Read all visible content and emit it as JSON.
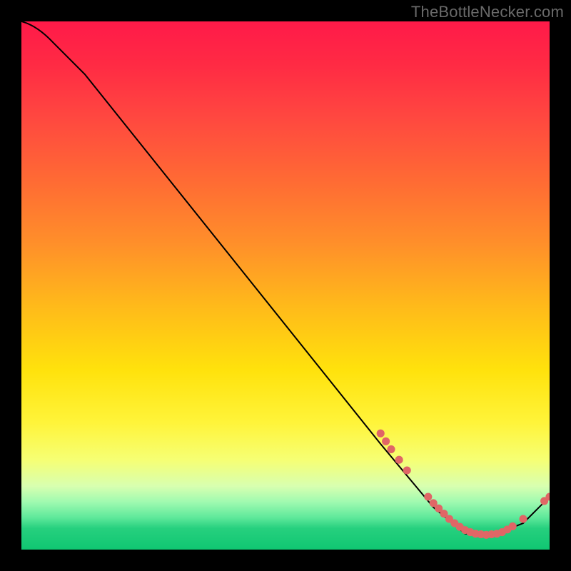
{
  "watermark": "TheBottleNecker.com",
  "chart_data": {
    "type": "line",
    "title": "",
    "xlabel": "",
    "ylabel": "",
    "xlim": [
      0,
      100
    ],
    "ylim": [
      0,
      100
    ],
    "curve": [
      {
        "x": 0,
        "y": 100
      },
      {
        "x": 6,
        "y": 96
      },
      {
        "x": 12,
        "y": 90
      },
      {
        "x": 68,
        "y": 20
      },
      {
        "x": 78,
        "y": 8
      },
      {
        "x": 84,
        "y": 3
      },
      {
        "x": 90,
        "y": 3
      },
      {
        "x": 95,
        "y": 5
      },
      {
        "x": 100,
        "y": 10
      }
    ],
    "markers": [
      {
        "x": 68,
        "y": 22
      },
      {
        "x": 69,
        "y": 20.5
      },
      {
        "x": 70,
        "y": 19
      },
      {
        "x": 71.5,
        "y": 17
      },
      {
        "x": 73,
        "y": 15
      },
      {
        "x": 77,
        "y": 10
      },
      {
        "x": 78,
        "y": 8.8
      },
      {
        "x": 79,
        "y": 7.8
      },
      {
        "x": 80,
        "y": 6.8
      },
      {
        "x": 81,
        "y": 5.8
      },
      {
        "x": 82,
        "y": 5
      },
      {
        "x": 83,
        "y": 4.3
      },
      {
        "x": 84,
        "y": 3.7
      },
      {
        "x": 85,
        "y": 3.3
      },
      {
        "x": 86,
        "y": 3
      },
      {
        "x": 87,
        "y": 2.9
      },
      {
        "x": 88,
        "y": 2.8
      },
      {
        "x": 89,
        "y": 2.9
      },
      {
        "x": 90,
        "y": 3
      },
      {
        "x": 91,
        "y": 3.3
      },
      {
        "x": 92,
        "y": 3.8
      },
      {
        "x": 93,
        "y": 4.4
      },
      {
        "x": 95,
        "y": 5.8
      },
      {
        "x": 99,
        "y": 9.2
      },
      {
        "x": 100,
        "y": 10
      }
    ],
    "colors": {
      "line": "#000000",
      "marker": "#e06666",
      "gradient_top": "#ff1a49",
      "gradient_mid": "#ffe20c",
      "gradient_bottom": "#10c672"
    }
  }
}
